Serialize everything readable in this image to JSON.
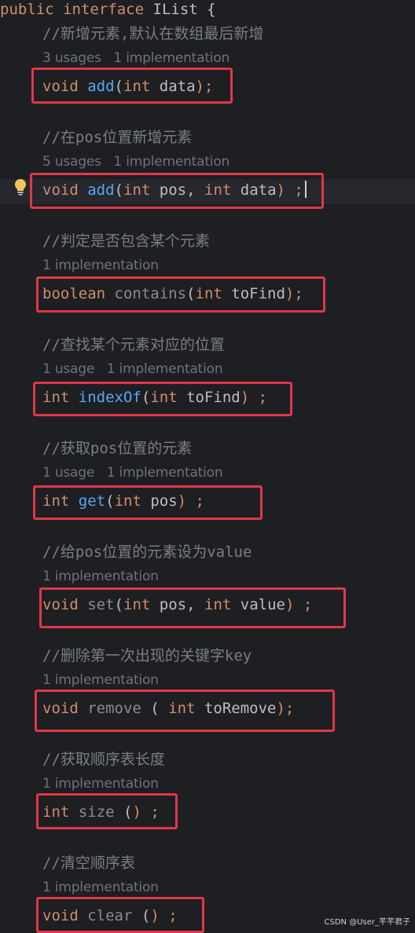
{
  "header": {
    "kw_public": "public",
    "kw_interface": "interface",
    "name": "IList",
    "brace": "{"
  },
  "methods": [
    {
      "comment": "//新增元素,默认在数组最后新增",
      "hint": "3 usages   1 implementation",
      "ret": "void",
      "name": "add",
      "open": "(",
      "params": [
        {
          "t": "int",
          "n": "data"
        }
      ],
      "tail": ");"
    },
    {
      "comment": "//在pos位置新增元素",
      "hint": "5 usages   1 implementation",
      "ret": "void",
      "name": "add",
      "open": "(",
      "params": [
        {
          "t": "int",
          "n": "pos"
        },
        {
          "t": "int",
          "n": "data"
        }
      ],
      "tail": ") ;"
    },
    {
      "comment": "//判定是否包含某个元素",
      "hint": "1 implementation",
      "ret": "boolean",
      "name": "contains",
      "open": "(",
      "params": [
        {
          "t": "int",
          "n": "toFind"
        }
      ],
      "tail": ");"
    },
    {
      "comment": "//查找某个元素对应的位置",
      "hint": "1 usage   1 implementation",
      "ret": "int",
      "name": "indexOf",
      "open": "(",
      "params": [
        {
          "t": "int",
          "n": "toFind"
        }
      ],
      "tail": ") ;"
    },
    {
      "comment": "//获取pos位置的元素",
      "hint": "1 usage   1 implementation",
      "ret": "int",
      "name": "get",
      "open": "(",
      "params": [
        {
          "t": "int",
          "n": "pos"
        }
      ],
      "tail": ") ;"
    },
    {
      "comment": "//给pos位置的元素设为value",
      "hint": "1 implementation",
      "ret": "void",
      "name": "set",
      "open": "(",
      "params": [
        {
          "t": "int",
          "n": "pos"
        },
        {
          "t": "int",
          "n": "value"
        }
      ],
      "tail": ") ;"
    },
    {
      "comment": "//删除第一次出现的关键字key",
      "hint": "1 implementation",
      "ret": "void",
      "name": "remove",
      "open": " ( ",
      "params": [
        {
          "t": "int",
          "n": "toRemove"
        }
      ],
      "tail": ");"
    },
    {
      "comment": "//获取顺序表长度",
      "hint": "1 implementation",
      "ret": "int",
      "name": "size",
      "open": " (",
      "params": [],
      "tail": ") ;"
    },
    {
      "comment": "//清空顺序表",
      "hint": "1 implementation",
      "ret": "void",
      "name": "clear",
      "open": " (",
      "params": [],
      "tail": ") ;"
    }
  ],
  "watermark": "CSDN @User_芊芊君子",
  "colors": {
    "background": "#1e1f22",
    "keyword": "#cf8e6d",
    "method_used": "#56a8f5",
    "method_unused": "#8c8c8c",
    "comment": "#7a7e85",
    "highlight_box": "#e0374a"
  },
  "icons": {
    "gutter": "lightbulb-icon"
  }
}
